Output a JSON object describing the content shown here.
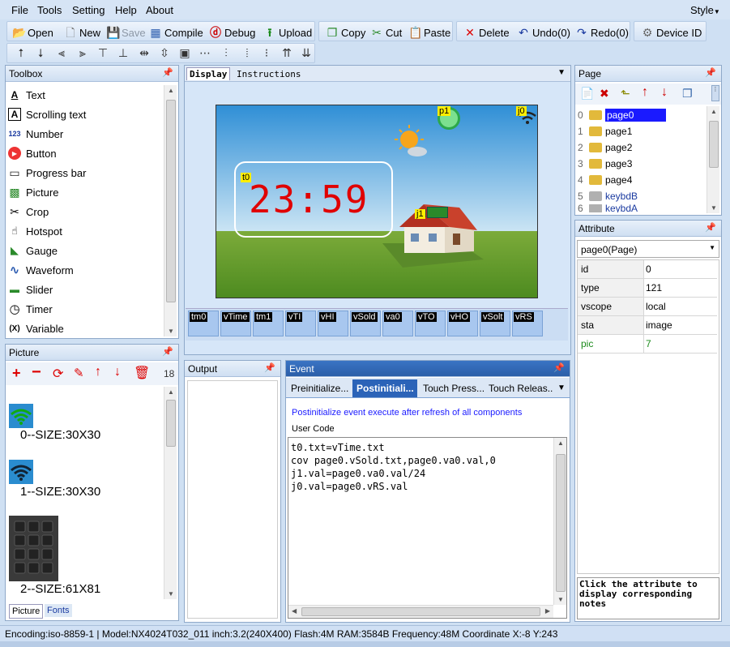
{
  "menu": [
    "File",
    "Tools",
    "Setting",
    "Help",
    "About"
  ],
  "style_label": "Style",
  "toolbar": {
    "open": "Open",
    "new": "New",
    "save": "Save",
    "compile": "Compile",
    "debug": "Debug",
    "upload": "Upload",
    "copy": "Copy",
    "cut": "Cut",
    "paste": "Paste",
    "delete": "Delete",
    "undo": "Undo(0)",
    "redo": "Redo(0)",
    "device_id": "Device  ID"
  },
  "toolbox": {
    "title": "Toolbox",
    "items": [
      {
        "label": "Text",
        "icon": "text-icon"
      },
      {
        "label": "Scrolling text",
        "icon": "scrolling-text-icon"
      },
      {
        "label": "Number",
        "icon": "number-icon"
      },
      {
        "label": "Button",
        "icon": "button-icon"
      },
      {
        "label": "Progress bar",
        "icon": "progress-bar-icon"
      },
      {
        "label": "Picture",
        "icon": "picture-icon"
      },
      {
        "label": "Crop",
        "icon": "crop-icon"
      },
      {
        "label": "Hotspot",
        "icon": "hotspot-icon"
      },
      {
        "label": "Gauge",
        "icon": "gauge-icon"
      },
      {
        "label": "Waveform",
        "icon": "waveform-icon"
      },
      {
        "label": "Slider",
        "icon": "slider-icon"
      },
      {
        "label": "Timer",
        "icon": "timer-icon"
      },
      {
        "label": "Variable",
        "icon": "variable-icon"
      }
    ]
  },
  "picture_panel": {
    "title": "Picture",
    "count": "18",
    "items": [
      "0--SIZE:30X30",
      "1--SIZE:30X30",
      "2--SIZE:61X81"
    ],
    "tabs": [
      "Picture",
      "Fonts"
    ]
  },
  "display": {
    "tabs": [
      "Display",
      "Instructions"
    ],
    "clock": "23:59",
    "labels": {
      "t0": "t0",
      "p1": "p1",
      "j0": "j0",
      "j1": "j1"
    },
    "variables": [
      "tm0",
      "vTime",
      "tm1",
      "vTI",
      "vHI",
      "vSold",
      "va0",
      "vTO",
      "vHO",
      "vSolt",
      "vRS"
    ]
  },
  "output": {
    "title": "Output"
  },
  "event": {
    "title": "Event",
    "tabs": [
      "Preinitialize...",
      "Postinitiali...",
      "Touch Press...",
      "Touch Releas..."
    ],
    "active_tab": 1,
    "description": "Postinitialize event execute after refresh of all components",
    "user_code_label": "User Code",
    "code": [
      "t0.txt=vTime.txt",
      "cov page0.vSold.txt,page0.va0.val,0",
      "j1.val=page0.va0.val/24",
      "j0.val=page0.vRS.val"
    ]
  },
  "page_panel": {
    "title": "Page",
    "pages": [
      {
        "index": "0",
        "name": "page0",
        "selected": true
      },
      {
        "index": "1",
        "name": "page1"
      },
      {
        "index": "2",
        "name": "page2"
      },
      {
        "index": "3",
        "name": "page3"
      },
      {
        "index": "4",
        "name": "page4"
      },
      {
        "index": "5",
        "name": "keybdB",
        "locked": true
      },
      {
        "index": "6",
        "name": "keybdA",
        "locked": true
      }
    ]
  },
  "attribute_panel": {
    "title": "Attribute",
    "selected": "page0(Page)",
    "rows": [
      {
        "key": "id",
        "value": "0"
      },
      {
        "key": "type",
        "value": "121"
      },
      {
        "key": "vscope",
        "value": "local"
      },
      {
        "key": "sta",
        "value": "image"
      },
      {
        "key": "pic",
        "value": "7",
        "highlight": true
      }
    ],
    "note": "Click the attribute to display corresponding notes"
  },
  "status_bar": "Encoding:iso-8859-1 | Model:NX4024T032_011  inch:3.2(240X400) Flash:4M RAM:3584B Frequency:48M     Coordinate X:-8  Y:243",
  "colors": {
    "accent": "#1a1aff",
    "clock_red": "#e00000",
    "label_yellow": "#ffee00"
  }
}
